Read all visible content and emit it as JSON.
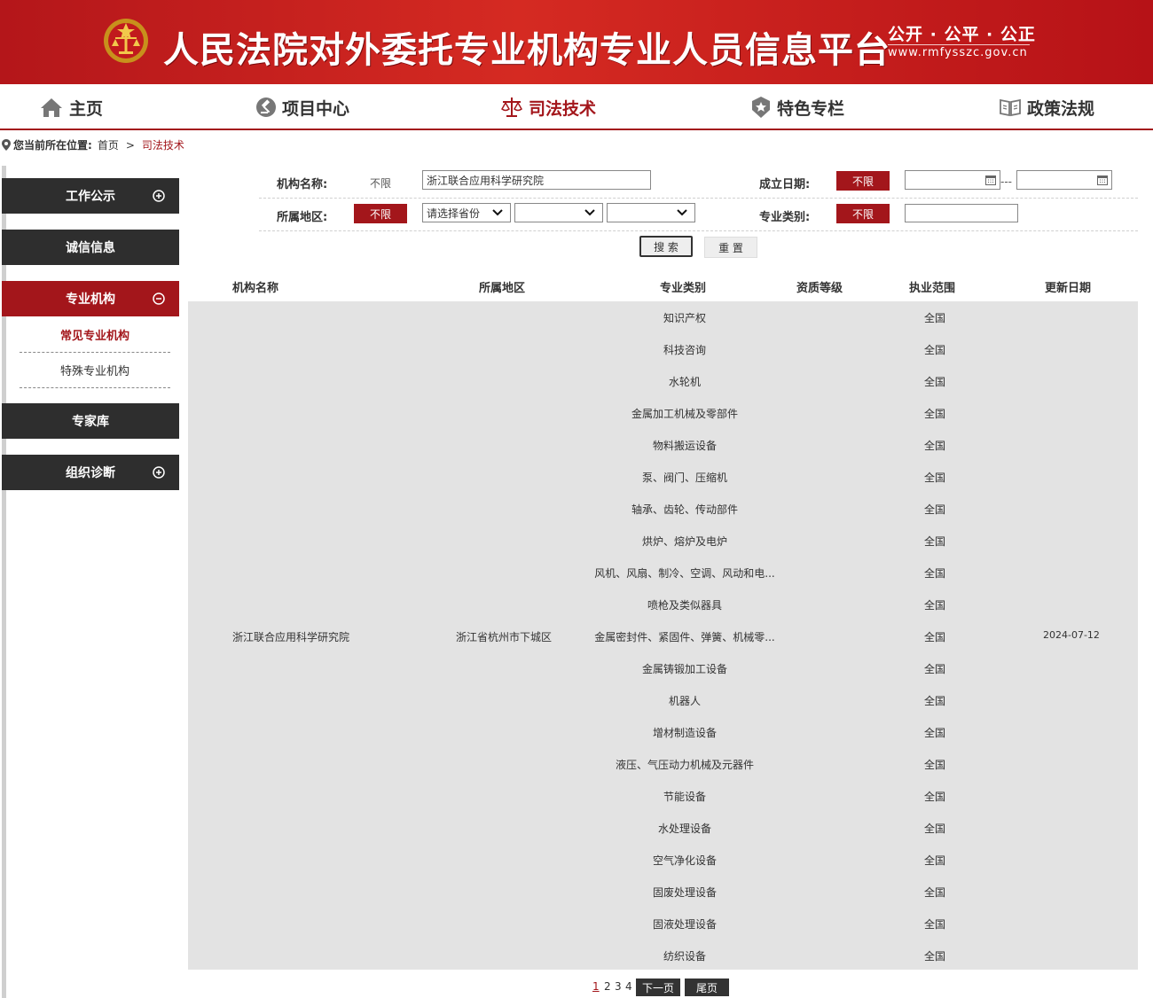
{
  "banner": {
    "title": "人民法院对外委托专业机构专业人员信息平台",
    "slogan": "公开 · 公平 · 公正",
    "domain": "www.rmfysszc.gov.cn"
  },
  "nav": [
    {
      "label": "主页",
      "icon": "home-icon"
    },
    {
      "label": "项目中心",
      "icon": "gavel-icon"
    },
    {
      "label": "司法技术",
      "icon": "scales-icon",
      "active": true
    },
    {
      "label": "特色专栏",
      "icon": "star-badge-icon"
    },
    {
      "label": "政策法规",
      "icon": "book-icon"
    }
  ],
  "breadcrumb": {
    "prefix": "您当前所在位置:",
    "home": "首页",
    "sep": ">",
    "current": "司法技术"
  },
  "sidebar": {
    "items": [
      {
        "label": "工作公示"
      },
      {
        "label": "诚信信息"
      },
      {
        "label": "专业机构"
      },
      {
        "label": "专家库"
      },
      {
        "label": "组织诊断"
      }
    ],
    "sub_items": [
      {
        "label": "常见专业机构",
        "active": true
      },
      {
        "label": "特殊专业机构"
      }
    ]
  },
  "form": {
    "org_name_label": "机构名称:",
    "org_name_unlimited": "不限",
    "org_name_value": "浙江联合应用科学研究院",
    "found_date_label": "成立日期:",
    "found_date_unlimited": "不限",
    "date_sep": "---",
    "region_label": "所属地区:",
    "region_unlimited": "不限",
    "province_placeholder": "请选择省份",
    "category_label": "专业类别:",
    "category_unlimited": "不限",
    "search_button": "搜 索",
    "reset_button": "重 置"
  },
  "table": {
    "headers": [
      "机构名称",
      "所属地区",
      "专业类别",
      "资质等级",
      "执业范围",
      "更新日期"
    ],
    "org_name": "浙江联合应用科学研究院",
    "region": "浙江省杭州市下城区",
    "update_date": "2024-07-12",
    "categories": [
      "知识产权",
      "科技咨询",
      "水轮机",
      "金属加工机械及零部件",
      "物料搬运设备",
      "泵、阀门、压缩机",
      "轴承、齿轮、传动部件",
      "烘炉、熔炉及电炉",
      "风机、风扇、制冷、空调、风动和电...",
      "喷枪及类似器具",
      "金属密封件、紧固件、弹簧、机械零...",
      "金属铸锻加工设备",
      "机器人",
      "增材制造设备",
      "液压、气压动力机械及元器件",
      "节能设备",
      "水处理设备",
      "空气净化设备",
      "固废处理设备",
      "固液处理设备",
      "纺织设备"
    ],
    "scope": "全国"
  },
  "pager": {
    "pages": [
      "1",
      "2",
      "3",
      "4"
    ],
    "next": "下一页",
    "last": "尾页"
  },
  "colors": {
    "brand_red": "#a3161b",
    "dark": "#2e2e2e",
    "row_bg": "#e3e3e3"
  }
}
